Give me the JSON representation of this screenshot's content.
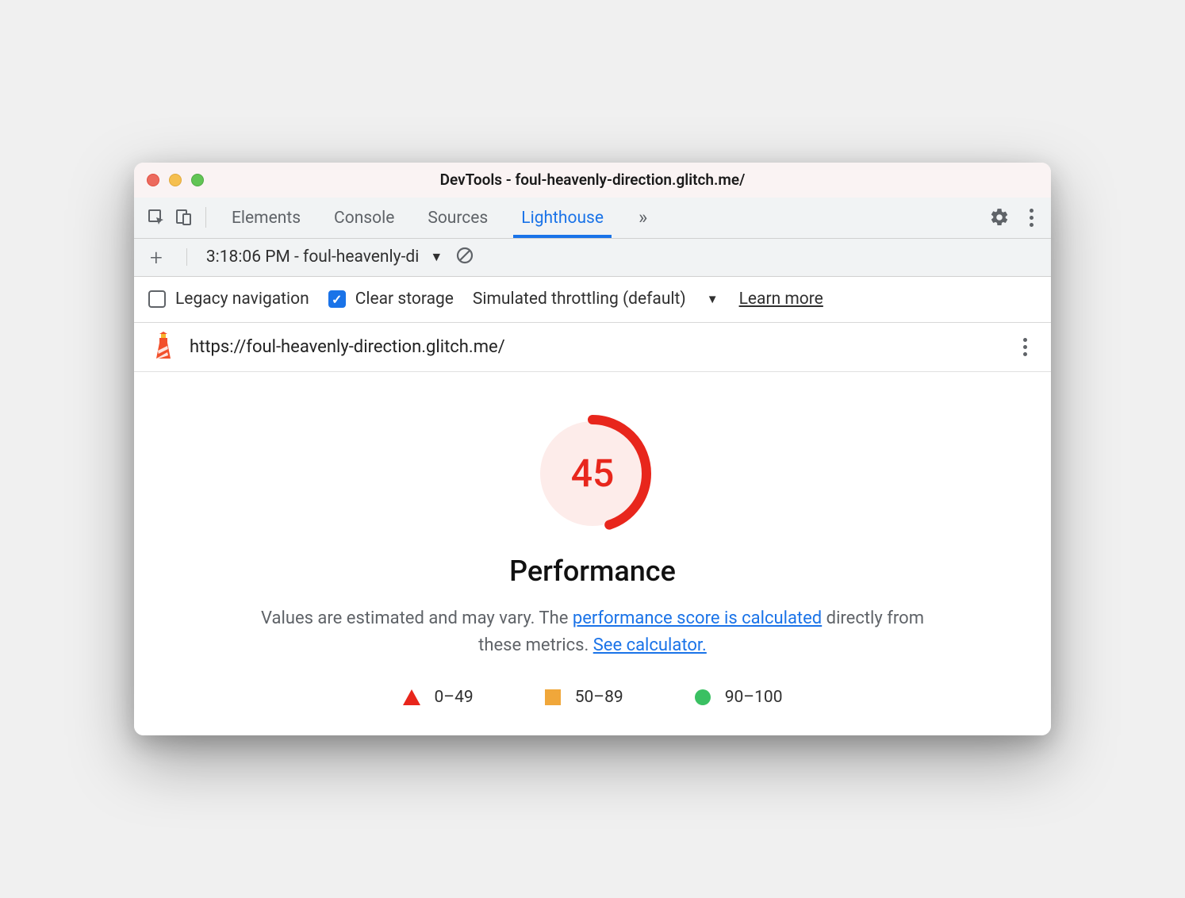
{
  "window": {
    "title": "DevTools - foul-heavenly-direction.glitch.me/"
  },
  "tabs": {
    "elements": "Elements",
    "console": "Console",
    "sources": "Sources",
    "lighthouse": "Lighthouse"
  },
  "reportbar": {
    "selected": "3:18:06 PM - foul-heavenly-di"
  },
  "options": {
    "legacy_label": "Legacy navigation",
    "clear_label": "Clear storage",
    "throttling_label": "Simulated throttling (default)",
    "learn_more": "Learn more"
  },
  "urlbar": {
    "url": "https://foul-heavenly-direction.glitch.me/"
  },
  "report": {
    "score": "45",
    "title": "Performance",
    "desc_prefix": "Values are estimated and may vary. The ",
    "link1": "performance score is calculated",
    "desc_mid": " directly from these metrics. ",
    "link2": "See calculator.",
    "legend": {
      "low": "0–49",
      "mid": "50–89",
      "high": "90–100"
    }
  },
  "colors": {
    "accent": "#1a73e8",
    "fail": "#e8261c",
    "warn": "#f0a73a",
    "pass": "#3ac062"
  }
}
